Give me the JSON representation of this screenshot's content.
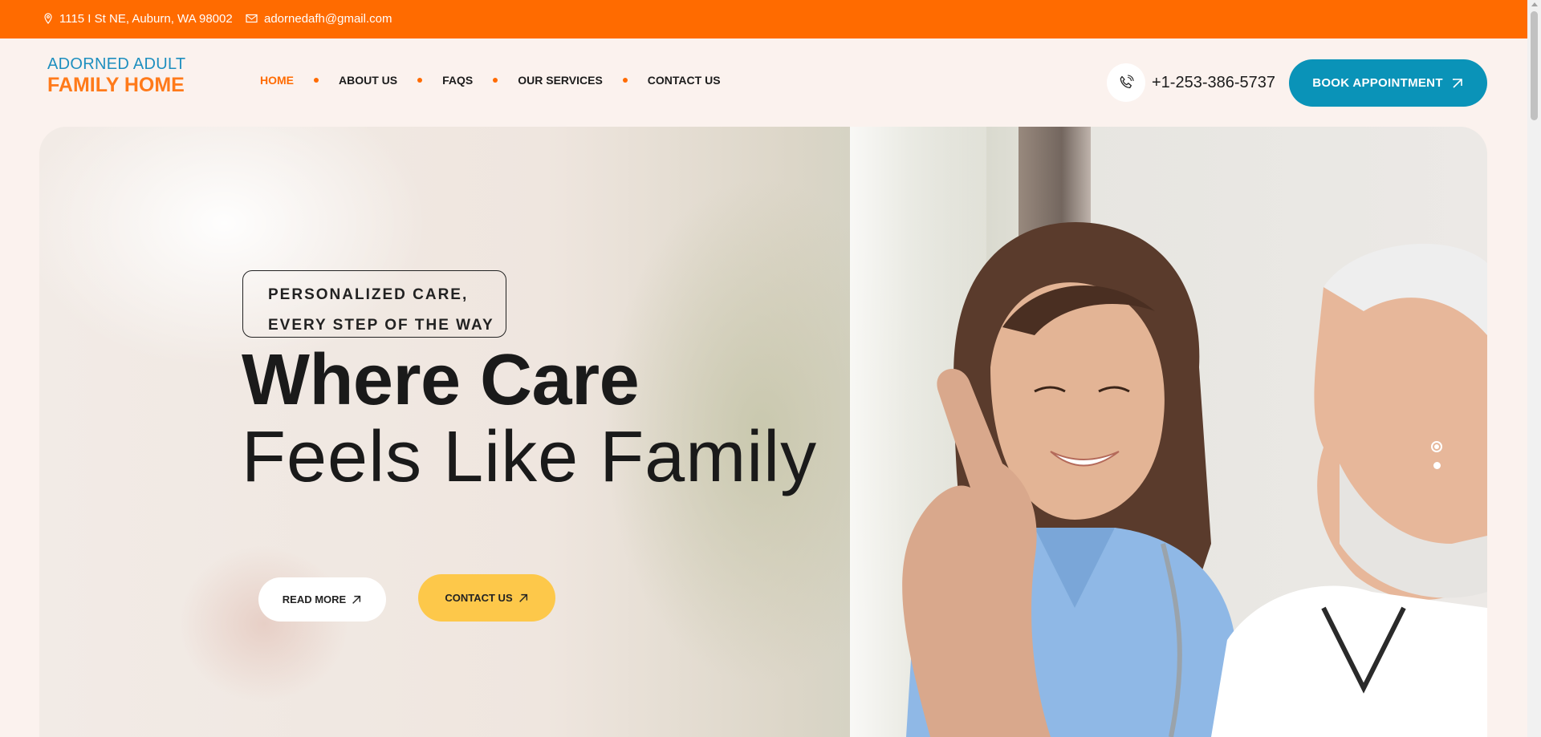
{
  "topbar": {
    "address": "1115 I St NE, Auburn, WA 98002",
    "email": "adornedafh@gmail.com",
    "address_icon": "location-pin-icon",
    "email_icon": "envelope-icon",
    "background_color": "#ff6b00"
  },
  "logo": {
    "line1": "ADORNED ADULT",
    "line2": "FAMILY HOME"
  },
  "nav": {
    "items": [
      {
        "label": "HOME",
        "active": true
      },
      {
        "label": "ABOUT US",
        "active": false
      },
      {
        "label": "FAQS",
        "active": false
      },
      {
        "label": "OUR SERVICES",
        "active": false
      },
      {
        "label": "CONTACT US",
        "active": false
      }
    ],
    "accent_color": "#ff6b00"
  },
  "header": {
    "phone": "+1-253-386-5737",
    "phone_icon": "phone-icon",
    "book_label": "BOOK APPOINTMENT",
    "book_color": "#0a93b8"
  },
  "hero": {
    "tagline_line1": "PERSONALIZED CARE,",
    "tagline_line2": "EVERY STEP OF THE WAY",
    "headline_line1": "Where Care",
    "headline_line2": "Feels Like Family",
    "read_more_label": "READ MORE",
    "contact_label": "CONTACT US",
    "contact_color": "#fdc84a",
    "slides_count": 2,
    "active_slide": 1
  }
}
